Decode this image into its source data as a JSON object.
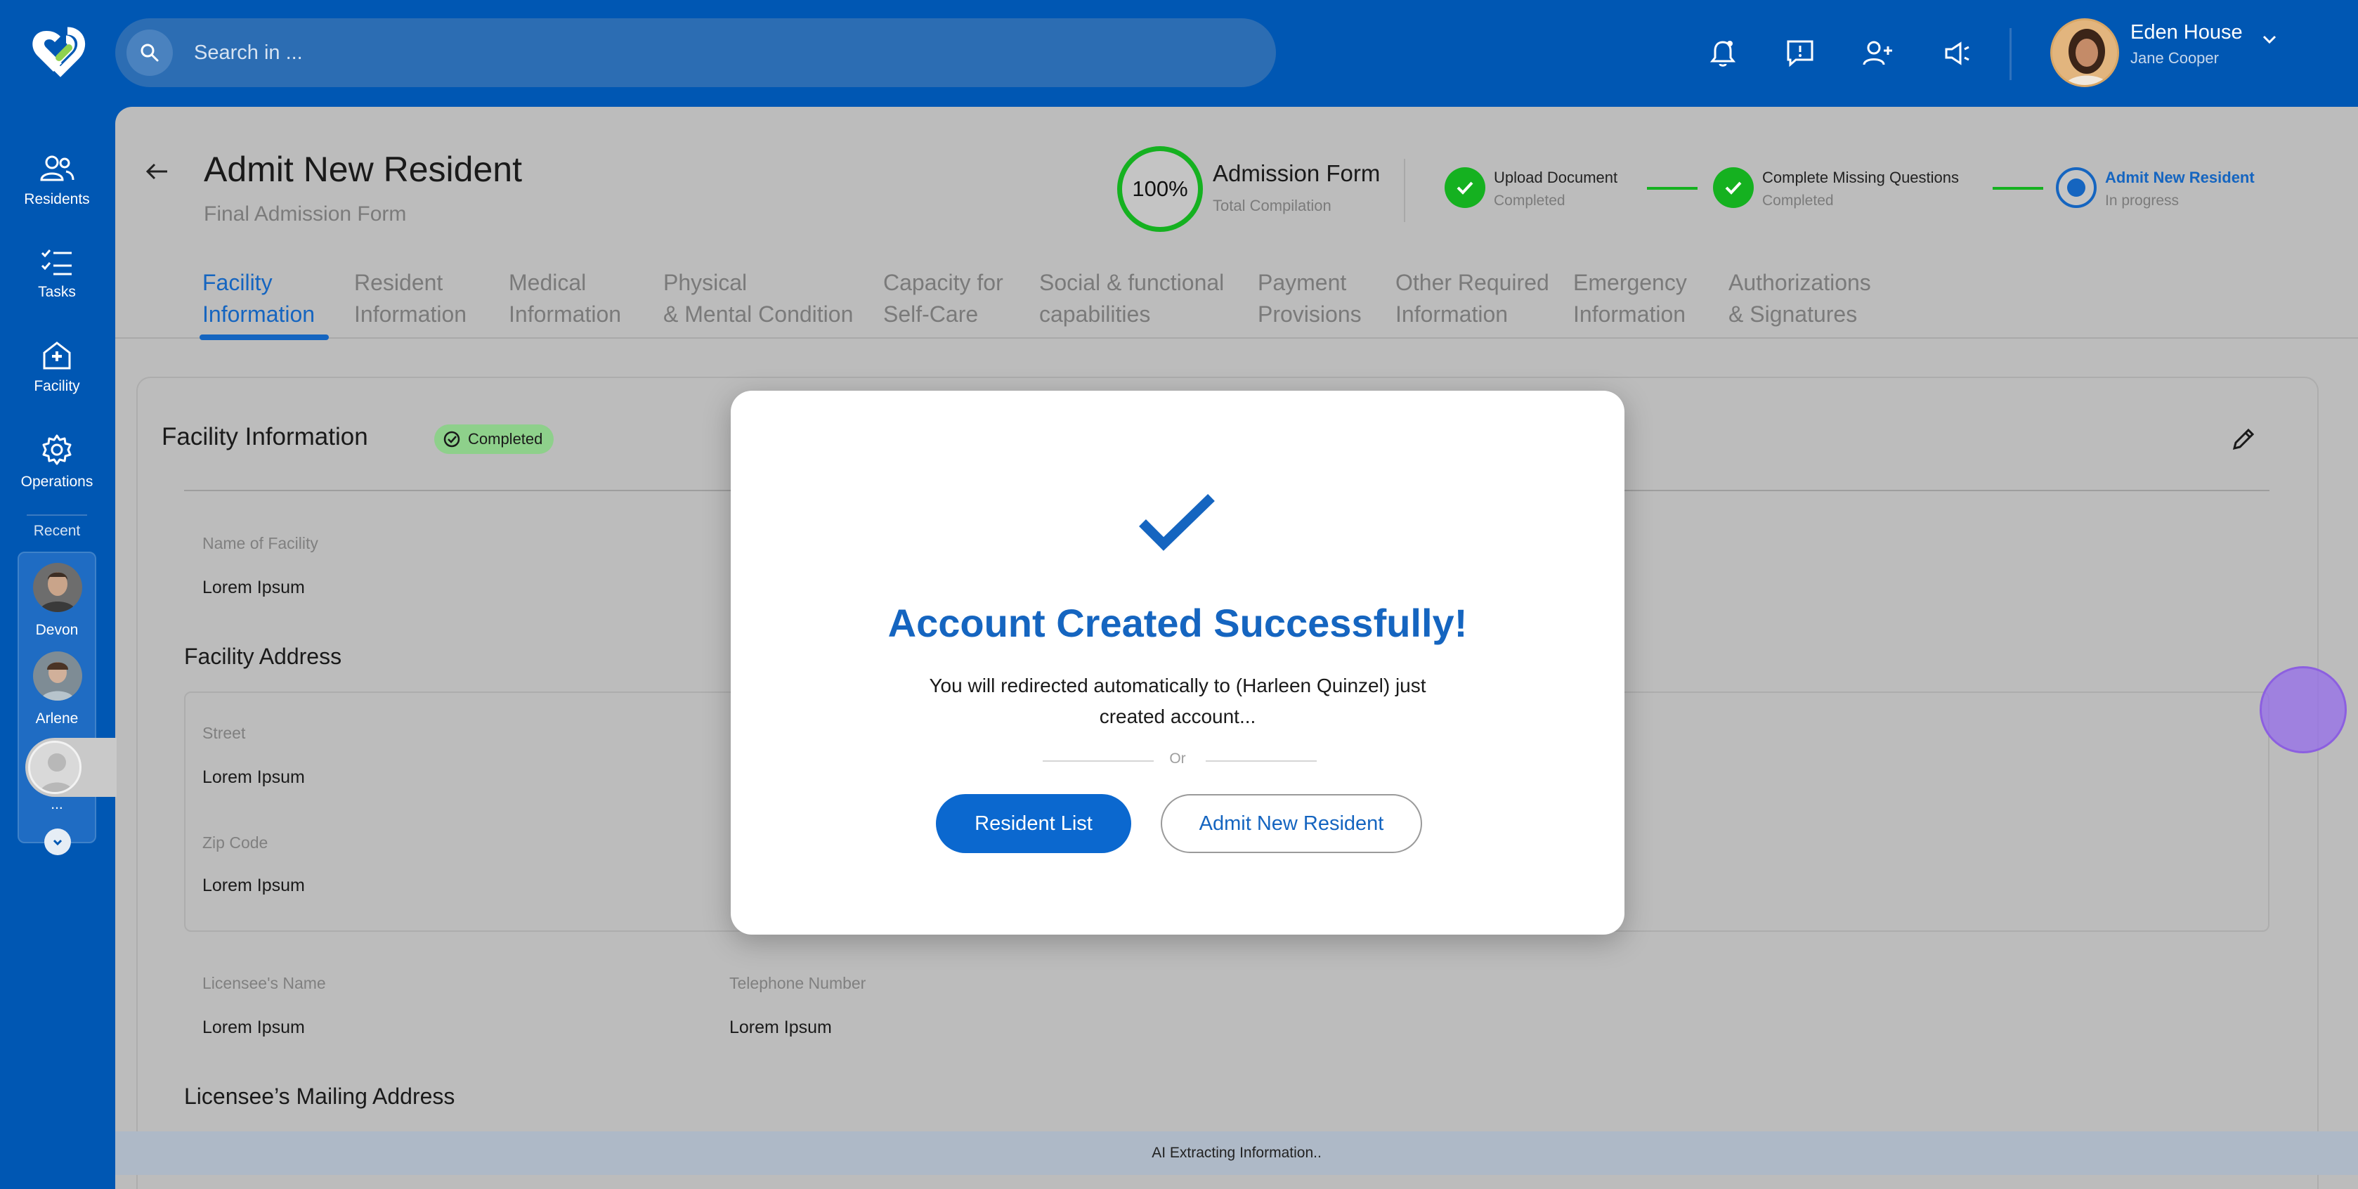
{
  "search": {
    "placeholder": "Search in ..."
  },
  "user": {
    "facility": "Eden House",
    "name": "Jane Cooper"
  },
  "sidebar": {
    "items": [
      {
        "label": "Residents",
        "icon": "residents-icon"
      },
      {
        "label": "Tasks",
        "icon": "tasks-icon"
      },
      {
        "label": "Facility",
        "icon": "facility-icon"
      },
      {
        "label": "Operations",
        "icon": "gear-icon"
      }
    ],
    "recent_label": "Recent",
    "recent": [
      {
        "name": "Devon"
      },
      {
        "name": "Arlene"
      },
      {
        "name": "..."
      }
    ]
  },
  "page": {
    "title": "Admit New Resident",
    "subtitle": "Final Admission Form"
  },
  "progress": {
    "percent_label": "100%",
    "title": "Admission Form",
    "subtitle": "Total Compilation",
    "steps": [
      {
        "label": "Upload Document",
        "state": "Completed"
      },
      {
        "label": "Complete Missing Questions",
        "state": "Completed"
      },
      {
        "label": "Admit New Resident",
        "state": "In progress"
      }
    ]
  },
  "tabs": [
    {
      "label": "Facility\nInformation",
      "active": true
    },
    {
      "label": "Resident\nInformation"
    },
    {
      "label": "Medical\nInformation"
    },
    {
      "label": "Physical\n& Mental Condition"
    },
    {
      "label": "Capacity for\nSelf-Care"
    },
    {
      "label": "Social & functional\ncapabilities"
    },
    {
      "label": "Payment\nProvisions"
    },
    {
      "label": "Other Required\nInformation"
    },
    {
      "label": "Emergency\nInformation"
    },
    {
      "label": "Authorizations\n& Signatures"
    }
  ],
  "section": {
    "title": "Facility Information",
    "badge": "Completed",
    "name_of_facility_label": "Name of Facility",
    "name_of_facility": "Lorem Ipsum",
    "address_title": "Facility Address",
    "street_label": "Street",
    "street": "Lorem Ipsum",
    "zip_label": "Zip Code",
    "zip": "Lorem Ipsum",
    "licensee_name_label": "Licensee's Name",
    "licensee_name": "Lorem Ipsum",
    "telephone_label": "Telephone Number",
    "telephone": "Lorem Ipsum",
    "mailing_title": "Licensee’s Mailing Address"
  },
  "ai_status": "AI Extracting Information..",
  "modal": {
    "title": "Account Created Successfully!",
    "message": "You will redirected automatically to (Harleen Quinzel) just created account...",
    "or": "Or",
    "primary_button": "Resident List",
    "secondary_button": "Admit New Resident"
  },
  "colors": {
    "brand": "#0057b3",
    "accent": "#1565c0",
    "success": "#15b120"
  }
}
